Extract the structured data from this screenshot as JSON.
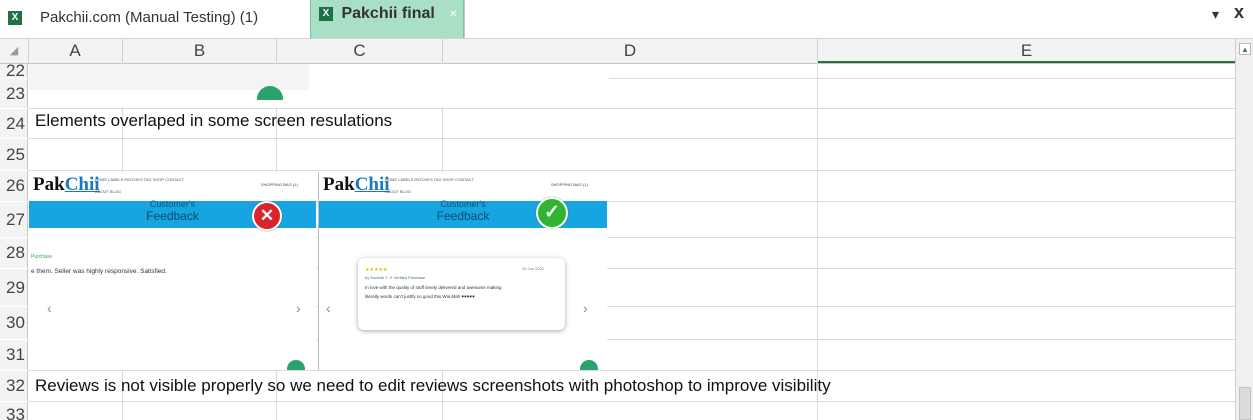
{
  "tabs": [
    {
      "label": "Pakchii.com (Manual Testing) (1)",
      "active": false
    },
    {
      "label": "Pakchii final",
      "active": true
    }
  ],
  "tab_close": "×",
  "window_close": "x",
  "dropdown": "▾",
  "columns": [
    "A",
    "B",
    "C",
    "D",
    "E"
  ],
  "rows": [
    "22",
    "23",
    "24",
    "25",
    "26",
    "27",
    "28",
    "29",
    "30",
    "31",
    "32",
    "33"
  ],
  "cells": {
    "r24": "Elements overlaped in some screen resulations",
    "r32": "Reviews is not visible properly so we need to edit reviews screenshots with photoshop to improve visibility"
  },
  "shot_left": {
    "brand_a": "Pak",
    "brand_b": "Chii",
    "nav_row1": "HOME    LABELS    PATCHES    TAG    SHOP    CONTACT",
    "nav_row2": "ABOUT    BLOG",
    "cart": "SHOPPING BAG (1)",
    "banner_top": "Customer's",
    "banner_bottom": "Feedback",
    "purchase": "Purchase",
    "review": "e them. Seller was highly responsive. Satisfied.",
    "prev": "‹",
    "next": "›",
    "status_icon": "✕"
  },
  "shot_right": {
    "brand_a": "Pak",
    "brand_b": "Chii",
    "nav_row1": "HOME    LABELS    PATCHES    TAG    SHOP    CONTACT",
    "nav_row2": "ABOUT    BLOG",
    "cart": "SHOPPING BAG (1)",
    "banner_top": "Customer's",
    "banner_bottom": "Feedback",
    "stars": "★★★★★",
    "reviewer": "by Sumbla Y.  ✔ Verified Purchase",
    "date": "10 Jun 2022",
    "review1": "In love with the quality of stuff timely delivered and awesome making",
    "review2": "literally words can't justify so good this Wia Mah ♥♥♥♥♥",
    "prev": "‹",
    "next": "›",
    "status_icon": "✓"
  },
  "colors": {
    "tab_active": "#a9dfc4",
    "banner": "#16a5e0",
    "fail": "#d7262b",
    "pass": "#2fb52f",
    "excel_green": "#1e7145"
  }
}
